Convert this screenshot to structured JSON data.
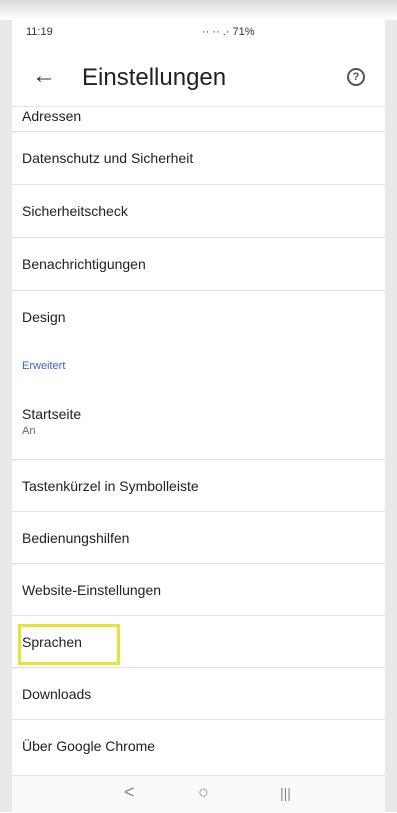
{
  "status_bar": {
    "time": "11:19",
    "indicators": "·· ·· .· 71%"
  },
  "app_bar": {
    "back_icon": "arrow-left-icon",
    "title": "Einstellungen",
    "help_icon": "help-circle-icon",
    "help_glyph": "?"
  },
  "settings": {
    "items_top": [
      {
        "label": "Adressen"
      },
      {
        "label": "Datenschutz und Sicherheit"
      },
      {
        "label": "Sicherheitscheck"
      },
      {
        "label": "Benachrichtigungen"
      },
      {
        "label": "Design"
      }
    ],
    "section_header": "Erweitert",
    "items_advanced": [
      {
        "label": "Startseite",
        "sublabel": "An"
      },
      {
        "label": "Tastenkürzel in Symbolleiste"
      },
      {
        "label": "Bedienungshilfen"
      },
      {
        "label": "Website-Einstellungen"
      },
      {
        "label": "Sprachen",
        "highlighted": true
      },
      {
        "label": "Downloads"
      },
      {
        "label": "Über Google Chrome"
      }
    ]
  },
  "nav_bar": {
    "back_glyph": "<",
    "home_glyph": "○",
    "recents_glyph": "|||"
  },
  "colors": {
    "section_header": "#3a66c5",
    "highlight_border": "#e7e337"
  }
}
